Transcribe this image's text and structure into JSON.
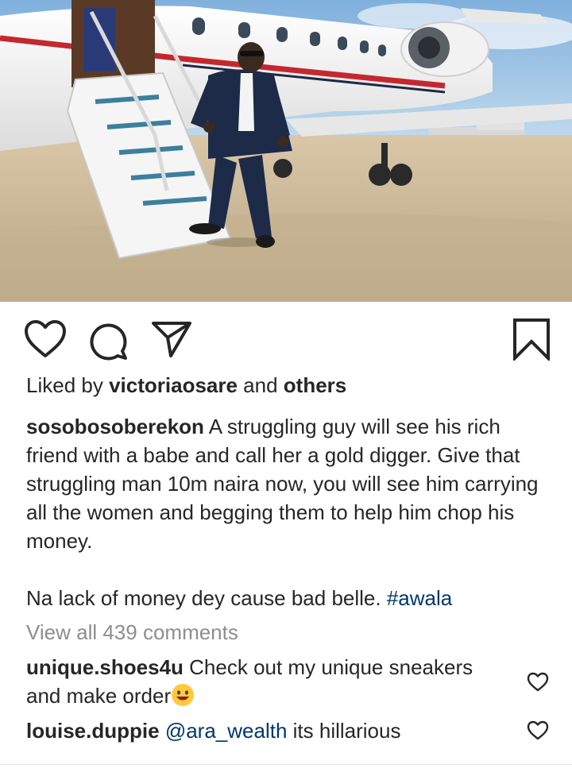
{
  "post": {
    "photo": {
      "icon": "private-jet-photo",
      "alt": "Man in a navy suit posing on the boarding stairs of a private jet",
      "colors": {
        "sky": "#9cc2e6",
        "tarmac": "#cbb99c",
        "fuselage": "#f4f4f2",
        "stripe_red": "#c4282e",
        "suit": "#1d2a48"
      }
    },
    "actions": {
      "like_icon": "heart-outline-icon",
      "comment_icon": "comment-bubble-icon",
      "share_icon": "paper-plane-icon",
      "save_icon": "bookmark-icon"
    },
    "likes": {
      "prefix": "Liked by ",
      "user": "victoriaosare",
      "and": " and ",
      "others": "others"
    },
    "caption": {
      "username": "sosobosoberekon",
      "text": " A struggling guy will see his rich friend with a babe and call her a gold digger. Give that struggling man 10m naira now, you will see him carrying all the women and begging them to help him chop his money.",
      "line2_text": "Na lack of money dey cause bad belle. ",
      "hashtag": "#awala"
    },
    "view_comments": "View all 439 comments",
    "comments": [
      {
        "username": "unique.shoes4u",
        "text": " Check out my unique sneakers and make order",
        "emoji": "smiling-face-emoji"
      },
      {
        "username": "louise.duppie",
        "mention": "@ara_wealth",
        "text": " its hillarious"
      }
    ],
    "colors": {
      "text": "#262626",
      "muted": "#8e8e8e",
      "link": "#00376b",
      "background": "#ffffff"
    }
  }
}
